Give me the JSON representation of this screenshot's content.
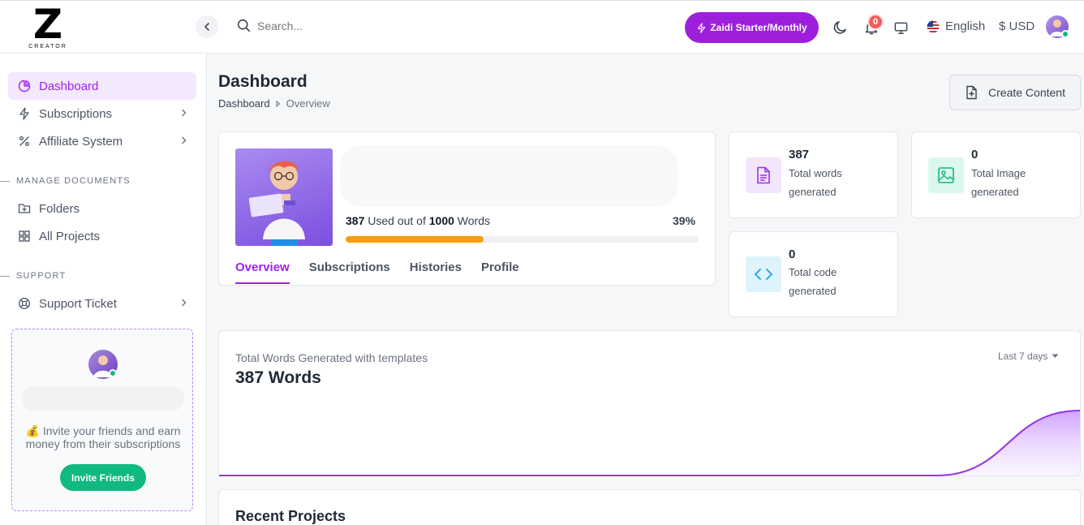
{
  "logo": {
    "letter": "Z",
    "text": "CREATOR"
  },
  "header": {
    "search_placeholder": "Search...",
    "plan_label": "Zaidi Starter/Monthly",
    "notification_count": "0",
    "language": "English",
    "currency": "$ USD",
    "icons": [
      "chevron-left-icon",
      "search-icon",
      "bolt-icon",
      "moon-icon",
      "bell-icon",
      "monitor-icon",
      "us-flag-icon"
    ]
  },
  "sidebar": {
    "items": [
      {
        "label": "Dashboard",
        "icon": "pie-chart-icon",
        "active": true
      },
      {
        "label": "Subscriptions",
        "icon": "bolt-icon"
      },
      {
        "label": "Affiliate System",
        "icon": "percent-icon"
      }
    ],
    "section_documents": "MANAGE DOCUMENTS",
    "documents": [
      {
        "label": "Folders",
        "icon": "folder-plus-icon"
      },
      {
        "label": "All Projects",
        "icon": "grid-icon"
      }
    ],
    "section_support": "SUPPORT",
    "support": [
      {
        "label": "Support Ticket",
        "icon": "lifebuoy-icon"
      }
    ],
    "invite": {
      "text": "💰 Invite your friends and earn money from their subscriptions",
      "button": "Invite Friends"
    }
  },
  "page": {
    "title": "Dashboard",
    "breadcrumb": [
      "Dashboard",
      "Overview"
    ],
    "create_button": "Create Content"
  },
  "profile": {
    "used": "387",
    "used_text": "Used out of",
    "total": "1000",
    "unit": "Words",
    "percent_label": "39%",
    "percent": 39,
    "tabs": [
      "Overview",
      "Subscriptions",
      "Histories",
      "Profile"
    ],
    "active_tab": "Overview"
  },
  "stats": [
    {
      "value": "387",
      "label": "Total words generated",
      "icon": "document-icon",
      "color": "#9333ea"
    },
    {
      "value": "0",
      "label": "Total Image generated",
      "icon": "image-icon",
      "color": "#10b981"
    },
    {
      "value": "0",
      "label": "Total code generated",
      "icon": "code-icon",
      "color": "#0ea5e9"
    }
  ],
  "chart": {
    "subtitle": "Total Words Generated with templates",
    "title": "387 Words",
    "range": "Last 7 days"
  },
  "chart_data": {
    "type": "area",
    "values": [
      0,
      0,
      0,
      0,
      0,
      0,
      387
    ],
    "xlabel": "",
    "ylabel": ""
  },
  "recent": {
    "title": "Recent Projects"
  },
  "colors": {
    "accent": "#a020f0",
    "plan_button": "#9d1fdc",
    "success": "#10b981",
    "progress": "#f59e0b"
  }
}
